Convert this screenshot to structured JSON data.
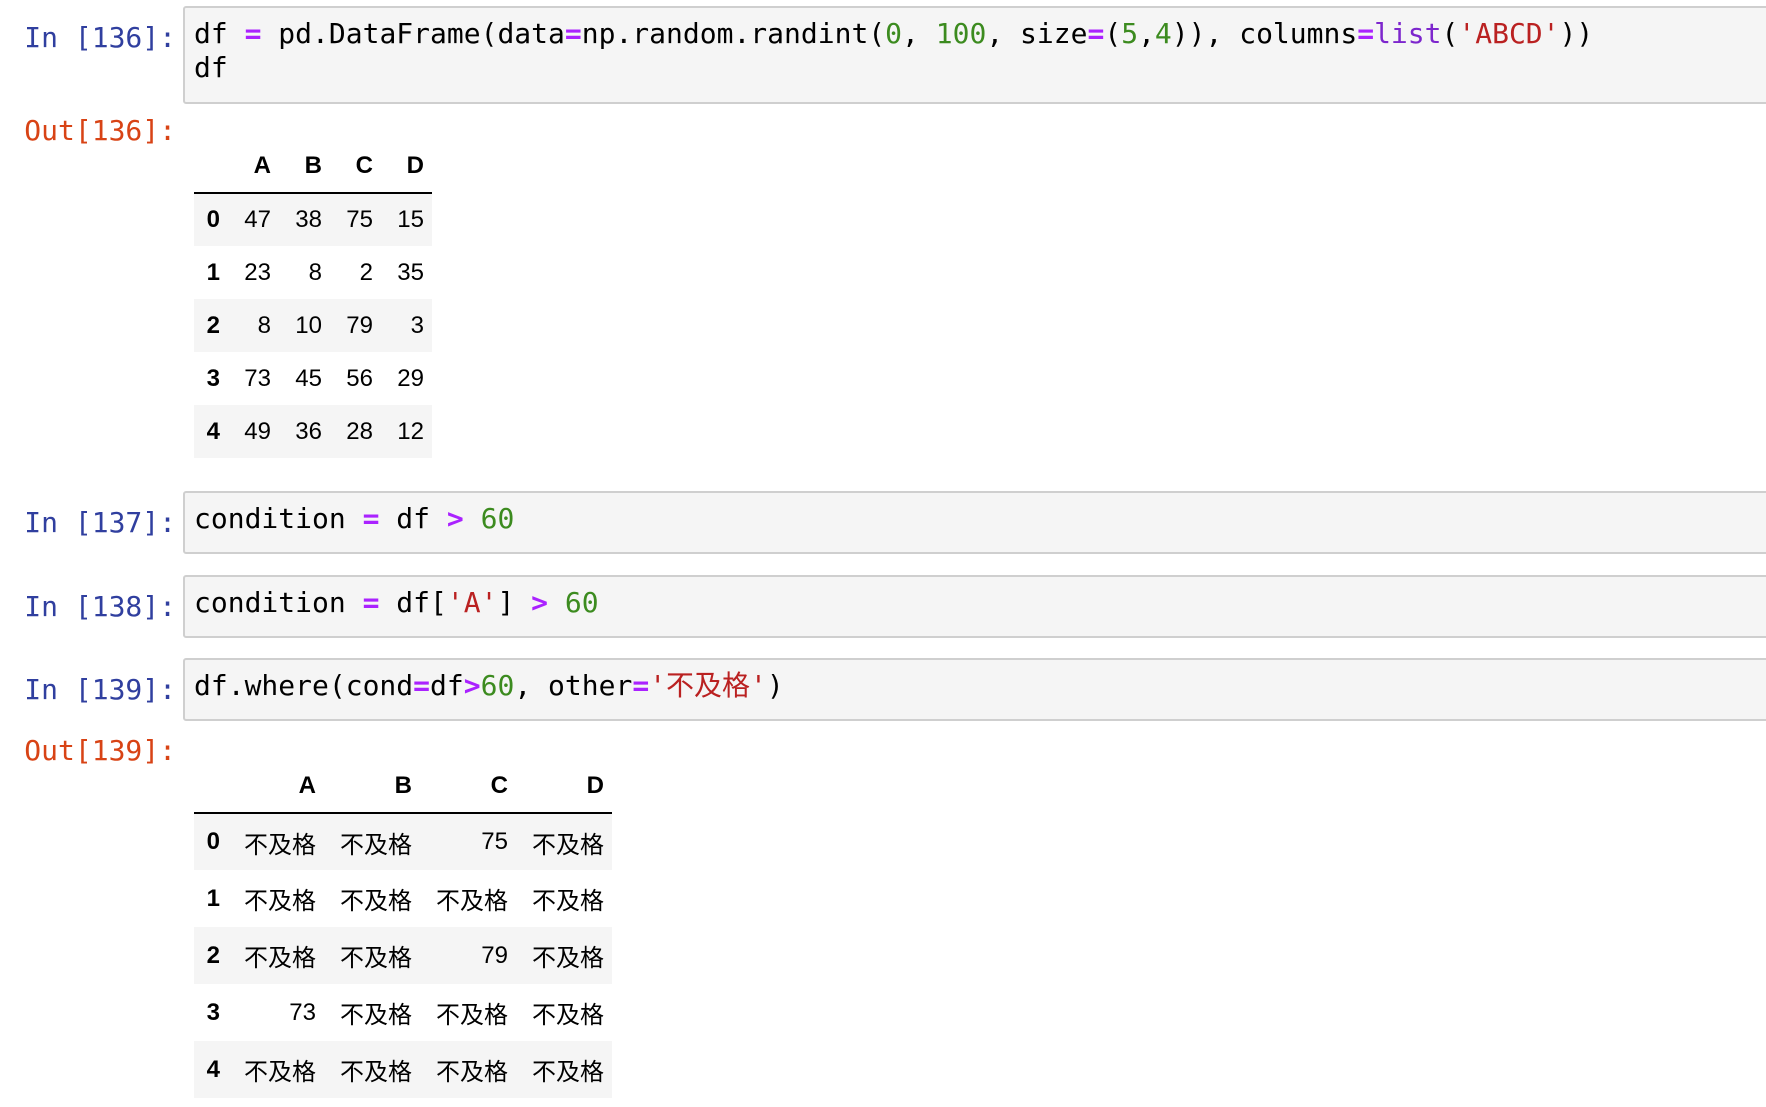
{
  "cells": {
    "c136": {
      "in_prompt": "In [136]:",
      "out_prompt": "Out[136]:",
      "code": {
        "l1_t1": "df ",
        "l1_t2": "=",
        "l1_t3": " pd.DataFrame(data",
        "l1_t4": "=",
        "l1_t5": "np.random.randint(",
        "l1_t6": "0",
        "l1_t7": ", ",
        "l1_t8": "100",
        "l1_t9": ", size",
        "l1_t10": "=",
        "l1_t11": "(",
        "l1_t12": "5",
        "l1_t13": ",",
        "l1_t14": "4",
        "l1_t15": ")), columns",
        "l1_t16": "=",
        "l1_t17": "list",
        "l1_t18": "(",
        "l1_t19": "'ABCD'",
        "l1_t20": "))",
        "l2": "df"
      },
      "table": {
        "columns": [
          "A",
          "B",
          "C",
          "D"
        ],
        "rows": [
          {
            "index": "0",
            "values": [
              "47",
              "38",
              "75",
              "15"
            ]
          },
          {
            "index": "1",
            "values": [
              "23",
              "8",
              "2",
              "35"
            ]
          },
          {
            "index": "2",
            "values": [
              "8",
              "10",
              "79",
              "3"
            ]
          },
          {
            "index": "3",
            "values": [
              "73",
              "45",
              "56",
              "29"
            ]
          },
          {
            "index": "4",
            "values": [
              "49",
              "36",
              "28",
              "12"
            ]
          }
        ]
      }
    },
    "c137": {
      "in_prompt": "In [137]:",
      "code": {
        "t1": "condition ",
        "t2": "=",
        "t3": " df ",
        "t4": ">",
        "t5": " ",
        "t6": "60"
      }
    },
    "c138": {
      "in_prompt": "In [138]:",
      "code": {
        "t1": "condition ",
        "t2": "=",
        "t3": " df[",
        "t4": "'A'",
        "t5": "] ",
        "t6": ">",
        "t7": " ",
        "t8": "60"
      }
    },
    "c139": {
      "in_prompt": "In [139]:",
      "out_prompt": "Out[139]:",
      "code": {
        "t1": "df.where(cond",
        "t2": "=",
        "t3": "df",
        "t4": ">",
        "t5": "60",
        "t6": ", other",
        "t7": "=",
        "t8": "'不及格'",
        "t9": ")"
      },
      "table": {
        "columns": [
          "A",
          "B",
          "C",
          "D"
        ],
        "rows": [
          {
            "index": "0",
            "values": [
              "不及格",
              "不及格",
              "75",
              "不及格"
            ]
          },
          {
            "index": "1",
            "values": [
              "不及格",
              "不及格",
              "不及格",
              "不及格"
            ]
          },
          {
            "index": "2",
            "values": [
              "不及格",
              "不及格",
              "79",
              "不及格"
            ]
          },
          {
            "index": "3",
            "values": [
              "73",
              "不及格",
              "不及格",
              "不及格"
            ]
          },
          {
            "index": "4",
            "values": [
              "不及格",
              "不及格",
              "不及格",
              "不及格"
            ]
          }
        ]
      }
    }
  },
  "colors": {
    "in_prompt": "#303f9f",
    "out_prompt": "#d84315",
    "operator": "#aa22ff",
    "number": "#3c8b1f",
    "string": "#ba2121",
    "builtin": "#7d26cd",
    "input_bg": "#f5f5f5",
    "input_border": "#cfcfcf"
  }
}
